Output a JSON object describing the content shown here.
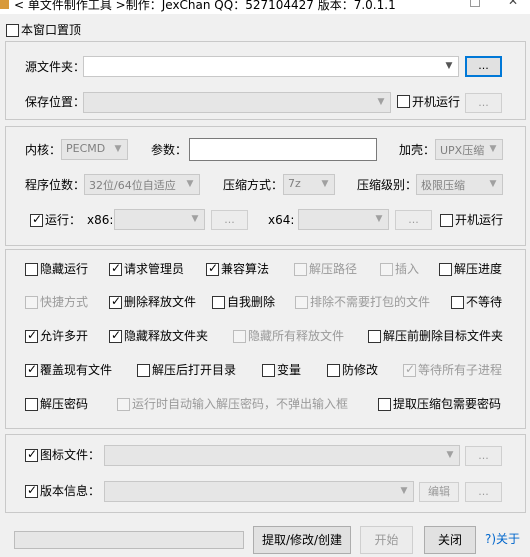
{
  "window": {
    "title": "< 单文件制作工具 >制作：JexChan  QQ：527104427  版本：7.0.1.1",
    "icon": "app-icon"
  },
  "top": {
    "always_on_top": {
      "label": "本窗口置顶",
      "checked": false
    }
  },
  "source": {
    "src_label": "源文件夹：",
    "src_value": "",
    "browse_label": "...",
    "save_label": "保存位置：",
    "save_value": "",
    "autorun_label": "开机运行",
    "autorun_checked": false,
    "save_browse_label": "..."
  },
  "core": {
    "core_label": "内核：",
    "core_value": "PECMD",
    "params_label": "参数：",
    "params_value": "",
    "shell_label": "加壳：",
    "shell_value": "UPX压缩",
    "bits_label": "程序位数：",
    "bits_value": "32位/64位自适应",
    "compress_method_label": "压缩方式：",
    "compress_method_value": "7z",
    "compress_level_label": "压缩级别：",
    "compress_level_value": "极限压缩",
    "run_label": "运行：",
    "run_checked": true,
    "x86_label": "x86:",
    "x86_value": "",
    "x86_browse": "...",
    "x64_label": "x64:",
    "x64_value": "",
    "x64_browse": "...",
    "autorun_label": "开机运行",
    "autorun_checked": false
  },
  "options": {
    "row1": [
      {
        "label": "隐藏运行",
        "checked": false,
        "enabled": true
      },
      {
        "label": "请求管理员",
        "checked": true,
        "enabled": true
      },
      {
        "label": "兼容算法",
        "checked": true,
        "enabled": true
      },
      {
        "label": "解压路径",
        "checked": false,
        "enabled": false
      },
      {
        "label": "插入",
        "checked": false,
        "enabled": false
      },
      {
        "label": "解压进度",
        "checked": false,
        "enabled": true
      }
    ],
    "row2": [
      {
        "label": "快捷方式",
        "checked": false,
        "enabled": false
      },
      {
        "label": "删除释放文件",
        "checked": true,
        "enabled": true
      },
      {
        "label": "自我删除",
        "checked": false,
        "enabled": true
      },
      {
        "label": "排除不需要打包的文件",
        "checked": false,
        "enabled": false
      },
      {
        "label": "不等待",
        "checked": false,
        "enabled": true
      }
    ],
    "row3": [
      {
        "label": "允许多开",
        "checked": true,
        "enabled": true
      },
      {
        "label": "隐藏释放文件夹",
        "checked": true,
        "enabled": true
      },
      {
        "label": "隐藏所有释放文件",
        "checked": false,
        "enabled": false
      },
      {
        "label": "解压前删除目标文件夹",
        "checked": false,
        "enabled": true
      }
    ],
    "row4": [
      {
        "label": "覆盖现有文件",
        "checked": true,
        "enabled": true
      },
      {
        "label": "解压后打开目录",
        "checked": false,
        "enabled": true
      },
      {
        "label": "变量",
        "checked": false,
        "enabled": true
      },
      {
        "label": "防修改",
        "checked": false,
        "enabled": true
      },
      {
        "label": "等待所有子进程",
        "checked": true,
        "enabled": false
      }
    ],
    "row5": [
      {
        "label": "解压密码",
        "checked": false,
        "enabled": true
      },
      {
        "label": "运行时自动输入解压密码，不弹出输入框",
        "checked": false,
        "enabled": false
      },
      {
        "label": "提取压缩包需要密码",
        "checked": false,
        "enabled": true
      }
    ]
  },
  "meta": {
    "icon_label": "图标文件：",
    "icon_checked": true,
    "icon_value": "",
    "icon_browse": "...",
    "version_label": "版本信息：",
    "version_checked": true,
    "version_value": "",
    "edit_label": "编辑",
    "version_browse": "..."
  },
  "bottom": {
    "progress": 0,
    "extract_label": "提取/修改/创建",
    "start_label": "开始",
    "close_label": "关闭",
    "about_label": "?)关于"
  }
}
